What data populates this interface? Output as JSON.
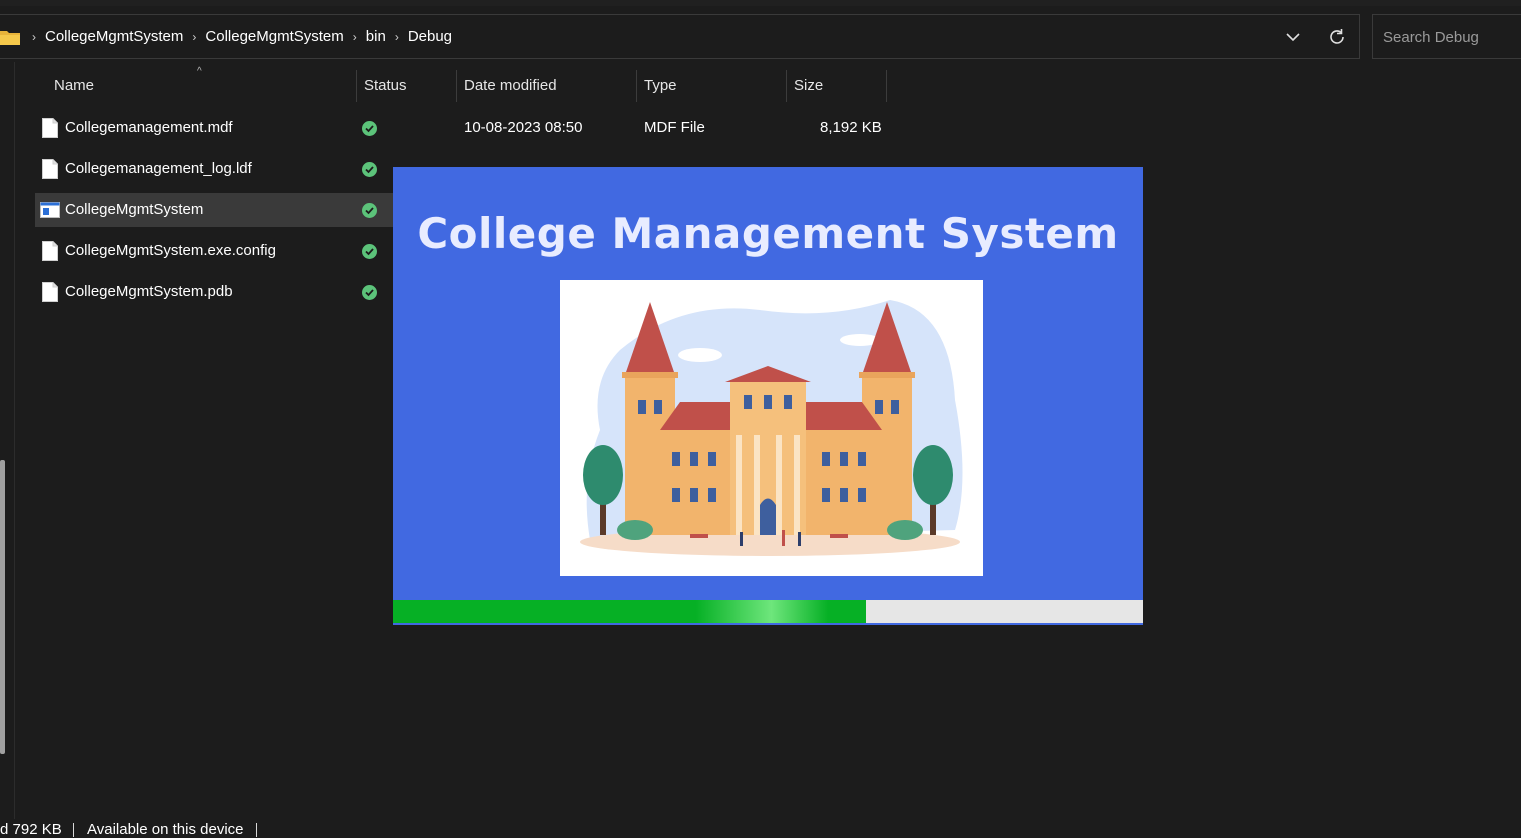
{
  "address_bar": {
    "breadcrumbs": [
      "CollegeMgmtSystem",
      "CollegeMgmtSystem",
      "bin",
      "Debug"
    ],
    "separator": "›",
    "dropdown_icon": "chevron-down-icon",
    "refresh_icon": "refresh-icon"
  },
  "search": {
    "placeholder": "Search Debug"
  },
  "file_list": {
    "columns": {
      "name": "Name",
      "status": "Status",
      "date_modified": "Date modified",
      "type": "Type",
      "size": "Size"
    },
    "rows": [
      {
        "name": "Collegemanagement.mdf",
        "icon": "file-icon",
        "status": "synced-icon",
        "date_modified": "10-08-2023 08:50",
        "type": "MDF File",
        "size": "8,192 KB"
      },
      {
        "name": "Collegemanagement_log.ldf",
        "icon": "file-icon",
        "status": "synced-icon",
        "date_modified": "",
        "type": "",
        "size": ""
      },
      {
        "name": "CollegeMgmtSystem",
        "icon": "application-icon",
        "status": "synced-icon",
        "selected": true
      },
      {
        "name": "CollegeMgmtSystem.exe.config",
        "icon": "file-icon",
        "status": "synced-icon"
      },
      {
        "name": "CollegeMgmtSystem.pdb",
        "icon": "file-icon",
        "status": "synced-icon"
      }
    ]
  },
  "splash": {
    "title": "College Management System",
    "image": "college-building-illustration",
    "progress": 0.63,
    "colors": {
      "background": "#4169e1",
      "progress": "#06b025"
    }
  },
  "status_bar": {
    "size_text": "d  792 KB",
    "availability": "Available on this device"
  }
}
